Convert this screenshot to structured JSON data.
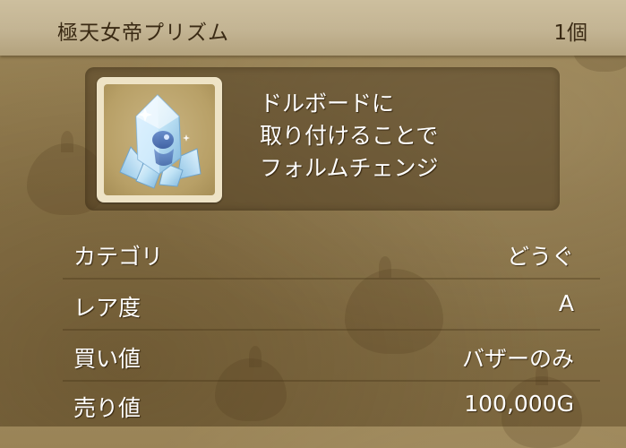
{
  "item": {
    "name": "極天女帝プリズム",
    "count": "1個",
    "icon": "prism-crystal-icon",
    "description": [
      "ドルボードに",
      "取り付けることで",
      "フォルムチェンジ"
    ]
  },
  "stats": [
    {
      "label": "カテゴリ",
      "value": "どうぐ"
    },
    {
      "label": "レア度",
      "value": "A"
    },
    {
      "label": "買い値",
      "value": "バザーのみ"
    },
    {
      "label": "売り値",
      "value": "100,000G"
    }
  ],
  "colors": {
    "header_bg": "#c3b493",
    "header_text": "#3a2a14",
    "body_bg": "#8a7449",
    "text": "#ffffff"
  }
}
